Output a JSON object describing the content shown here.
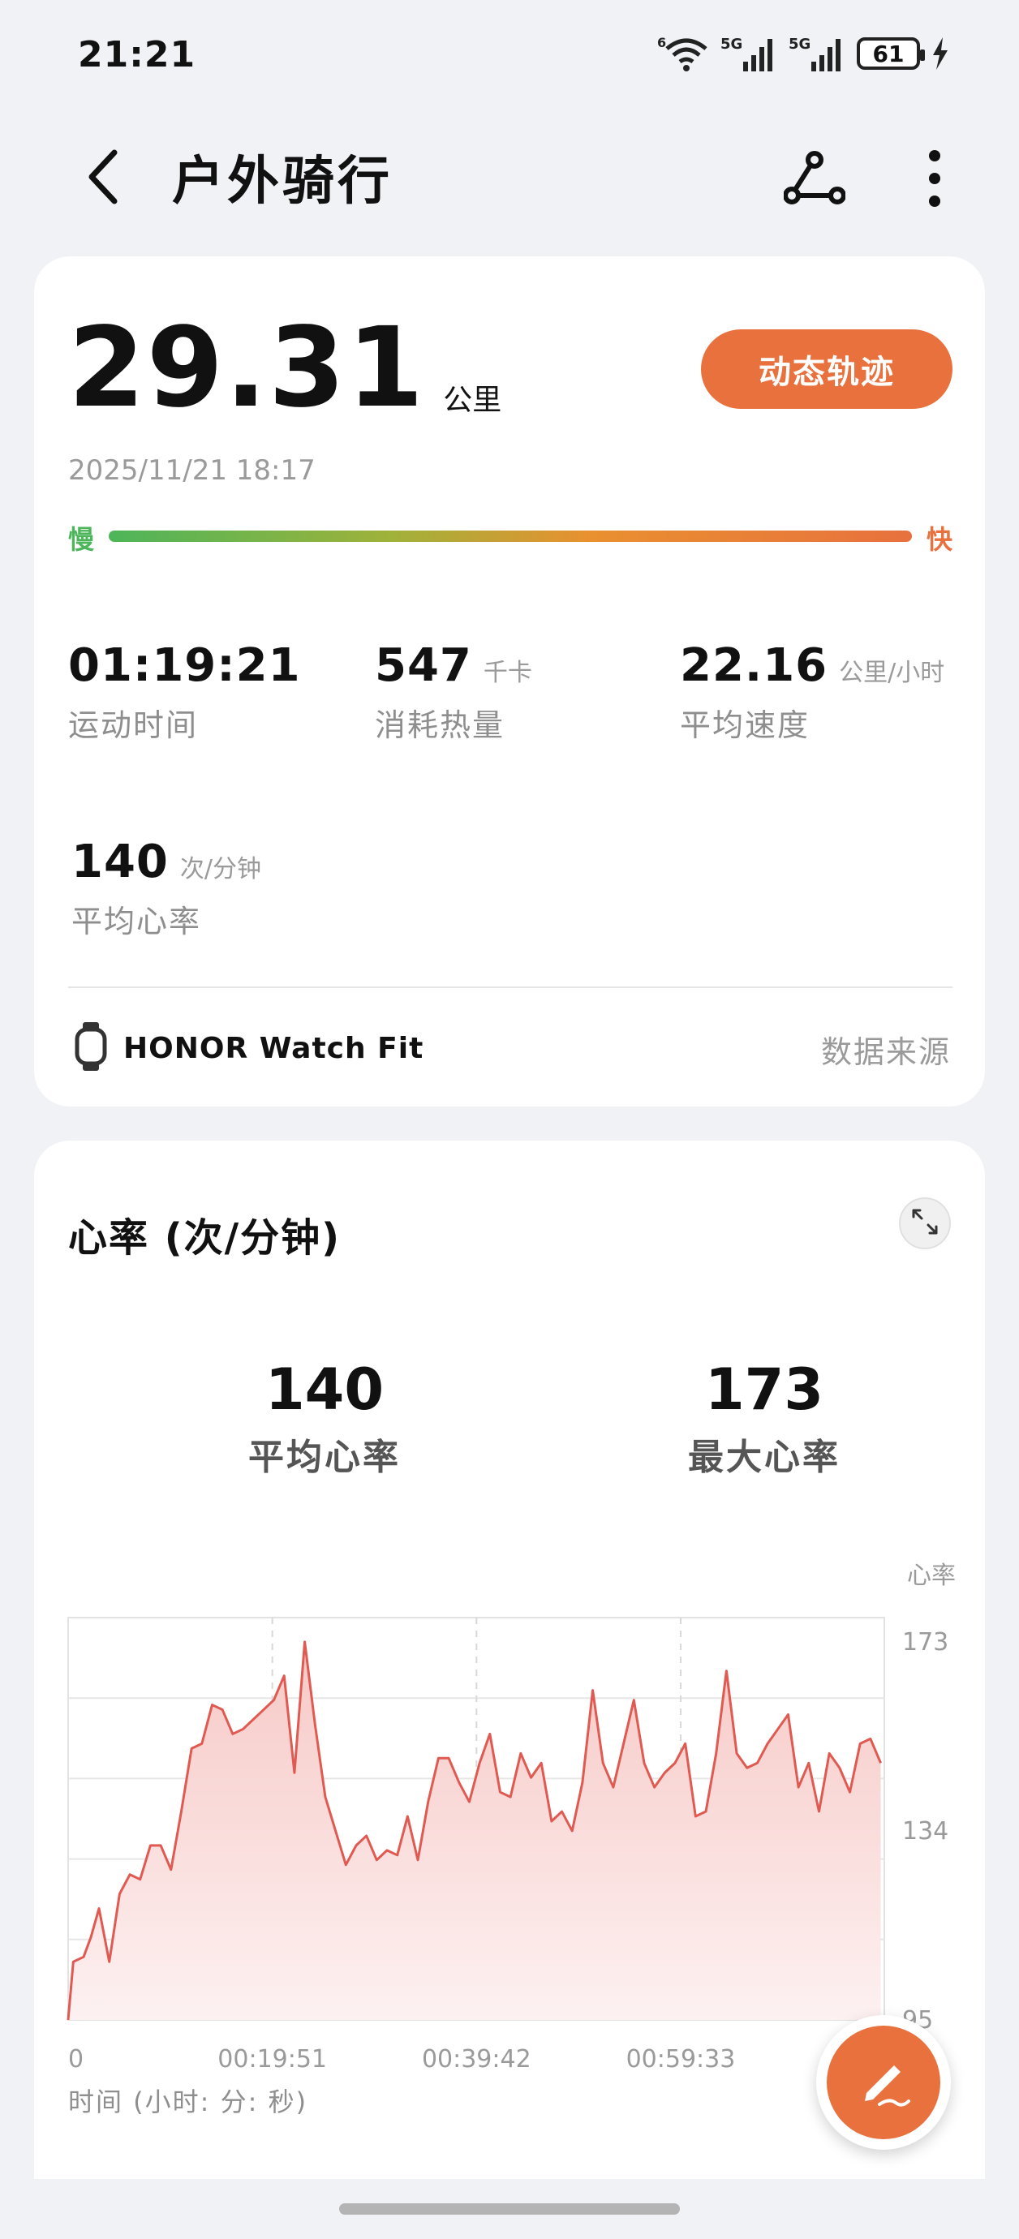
{
  "status_bar": {
    "time": "21:21",
    "battery": "61",
    "signal_1": "5G",
    "signal_2": "5G",
    "wifi_badge": "6"
  },
  "header": {
    "title": "户外骑行"
  },
  "summary": {
    "distance": "29.31",
    "distance_unit": "公里",
    "track_button": "动态轨迹",
    "date": "2025/11/21 18:17",
    "speed_slow": "慢",
    "speed_fast": "快",
    "metrics": [
      {
        "value": "01:19:21",
        "unit": "",
        "label": "运动时间"
      },
      {
        "value": "547",
        "unit": "千卡",
        "label": "消耗热量"
      },
      {
        "value": "22.16",
        "unit": "公里/小时",
        "label": "平均速度"
      },
      {
        "value": "140",
        "unit": "次/分钟",
        "label": "平均心率"
      }
    ],
    "device": "HONOR Watch Fit",
    "data_source": "数据来源"
  },
  "heart_rate": {
    "title": "心率 (次/分钟)",
    "avg_value": "140",
    "avg_label": "平均心率",
    "max_value": "173",
    "max_label": "最大心率",
    "x_axis_title": "时间 (小时: 分: 秒)"
  },
  "chart_data": {
    "type": "area",
    "title": "心率 (次/分钟)",
    "ylabel": "心率",
    "xlabel": "时间 (小时: 分: 秒)",
    "x_tick_labels": [
      "0",
      "00:19:51",
      "00:39:42",
      "00:59:33"
    ],
    "y_tick_labels": [
      "95",
      "134",
      "173"
    ],
    "ylim": [
      95,
      178
    ],
    "x_unit": "minutes",
    "xlim": [
      0,
      79.35
    ],
    "grid": true,
    "color": "#e05a52",
    "fill": "#fbe4e4",
    "series": [
      {
        "values": [
          [
            0,
            95
          ],
          [
            0.5,
            107
          ],
          [
            1.5,
            108
          ],
          [
            2.2,
            112
          ],
          [
            3,
            118
          ],
          [
            4,
            107
          ],
          [
            5,
            121
          ],
          [
            6,
            125
          ],
          [
            7,
            124
          ],
          [
            8,
            131
          ],
          [
            9,
            131
          ],
          [
            10,
            126
          ],
          [
            11,
            138
          ],
          [
            12,
            151
          ],
          [
            13,
            152
          ],
          [
            14,
            160
          ],
          [
            15,
            159
          ],
          [
            16,
            154
          ],
          [
            17,
            155
          ],
          [
            18,
            157
          ],
          [
            19,
            159
          ],
          [
            20,
            161
          ],
          [
            21,
            166
          ],
          [
            22,
            146
          ],
          [
            23,
            173
          ],
          [
            24,
            156
          ],
          [
            25,
            141
          ],
          [
            26,
            134
          ],
          [
            27,
            127
          ],
          [
            28,
            131
          ],
          [
            29,
            133
          ],
          [
            30,
            128
          ],
          [
            31,
            130
          ],
          [
            32,
            129
          ],
          [
            33,
            137
          ],
          [
            34,
            128
          ],
          [
            35,
            140
          ],
          [
            36,
            149
          ],
          [
            37,
            149
          ],
          [
            38,
            144
          ],
          [
            39,
            140
          ],
          [
            40,
            148
          ],
          [
            41,
            154
          ],
          [
            42,
            142
          ],
          [
            43,
            141
          ],
          [
            44,
            150
          ],
          [
            45,
            145
          ],
          [
            46,
            148
          ],
          [
            47,
            136
          ],
          [
            48,
            138
          ],
          [
            49,
            134
          ],
          [
            50,
            144
          ],
          [
            51,
            163
          ],
          [
            52,
            148
          ],
          [
            53,
            143
          ],
          [
            54,
            152
          ],
          [
            55,
            161
          ],
          [
            56,
            148
          ],
          [
            57,
            143
          ],
          [
            58,
            146
          ],
          [
            59,
            148
          ],
          [
            60,
            152
          ],
          [
            61,
            137
          ],
          [
            62,
            138
          ],
          [
            63,
            150
          ],
          [
            64,
            167
          ],
          [
            65,
            150
          ],
          [
            66,
            147
          ],
          [
            67,
            148
          ],
          [
            68,
            152
          ],
          [
            69,
            155
          ],
          [
            70,
            158
          ],
          [
            71,
            143
          ],
          [
            72,
            148
          ],
          [
            73,
            138
          ],
          [
            74,
            150
          ],
          [
            75,
            147
          ],
          [
            76,
            142
          ],
          [
            77,
            152
          ],
          [
            78,
            153
          ],
          [
            79,
            148
          ]
        ]
      }
    ]
  }
}
